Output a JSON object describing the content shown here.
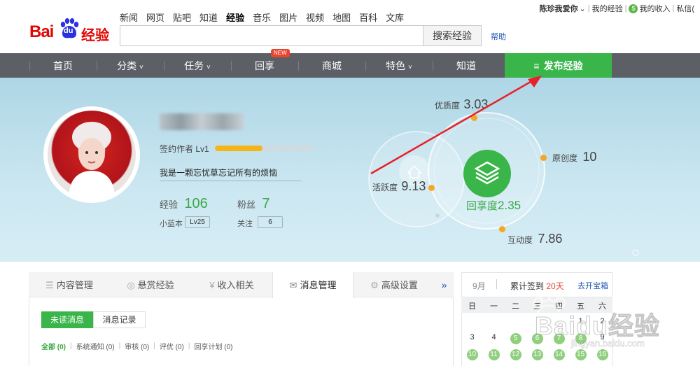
{
  "header": {
    "logo": {
      "bai": "Bai",
      "du": "du",
      "suffix": "经验"
    },
    "top_nav": [
      "新闻",
      "网页",
      "贴吧",
      "知道",
      "经验",
      "音乐",
      "图片",
      "视频",
      "地图",
      "百科",
      "文库"
    ],
    "active_top_nav": "经验",
    "search": {
      "value": "",
      "button": "搜索经验",
      "help": "帮助"
    },
    "user": {
      "name": "陈珍我爱你",
      "my_experience": "我的经验",
      "income_icon": "$",
      "my_income": "我的收入",
      "messages": "私信("
    }
  },
  "main_nav": {
    "items": [
      "首页",
      "分类",
      "任务",
      "回享",
      "商城",
      "特色",
      "知道"
    ],
    "dropdown_marker": "˅",
    "new_badge": "NEW",
    "publish": "发布经验",
    "publish_icon": "≡",
    "accent": "#39b54a"
  },
  "profile": {
    "sign_label": "签约作者 Lv1",
    "level_progress": 0.48,
    "motto": "我是一颗忘忧草忘记所有的烦恼",
    "experience_label": "经验",
    "experience_value": "106",
    "fans_label": "粉丝",
    "fans_value": "7",
    "blue_label": "小蓝本",
    "blue_value": "Lv25",
    "follow_label": "关注",
    "follow_value": "6"
  },
  "radar": {
    "quality_label": "优质度",
    "quality_value": "3.03",
    "originality_label": "原创度",
    "originality_value": "10",
    "activity_label": "活跃度",
    "activity_value": "9.13",
    "interaction_label": "互动度",
    "interaction_value": "7.86",
    "share_label": "回享度",
    "share_value": "2.35"
  },
  "tabs": {
    "items": [
      "内容管理",
      "悬赏经验",
      "收入相关",
      "消息管理",
      "高级设置"
    ],
    "icons": [
      "☰",
      "◎",
      "¥",
      "✉",
      "⚙"
    ],
    "active": "消息管理",
    "more": "»"
  },
  "messages": {
    "unread": "未读消息",
    "record": "消息记录",
    "filters": [
      {
        "label": "全部",
        "count": "(0)"
      },
      {
        "label": "系统通知",
        "count": "(0)"
      },
      {
        "label": "审核",
        "count": "(0)"
      },
      {
        "label": "评优",
        "count": "(0)"
      },
      {
        "label": "回享计划",
        "count": "(0)"
      }
    ]
  },
  "calendar": {
    "month": "9月",
    "checkin_prefix": "累计签到",
    "checkin_days": "20天",
    "treasure": "去开宝箱",
    "weekdays": [
      "日",
      "一",
      "二",
      "三",
      "四",
      "五",
      "六"
    ],
    "row1": [
      "",
      "",
      "",
      "",
      "",
      "1",
      "2"
    ],
    "row2": [
      "3",
      "4",
      "5",
      "6",
      "7",
      "8",
      "9"
    ],
    "row3": [
      "10",
      "11",
      "12",
      "13",
      "14",
      "15",
      "16"
    ],
    "signed": [
      "5",
      "6",
      "7",
      "8",
      "10",
      "11",
      "12",
      "13",
      "14",
      "15",
      "16"
    ]
  },
  "watermark": {
    "text": "Baidu经验",
    "url": "jingyan.baidu.com"
  }
}
